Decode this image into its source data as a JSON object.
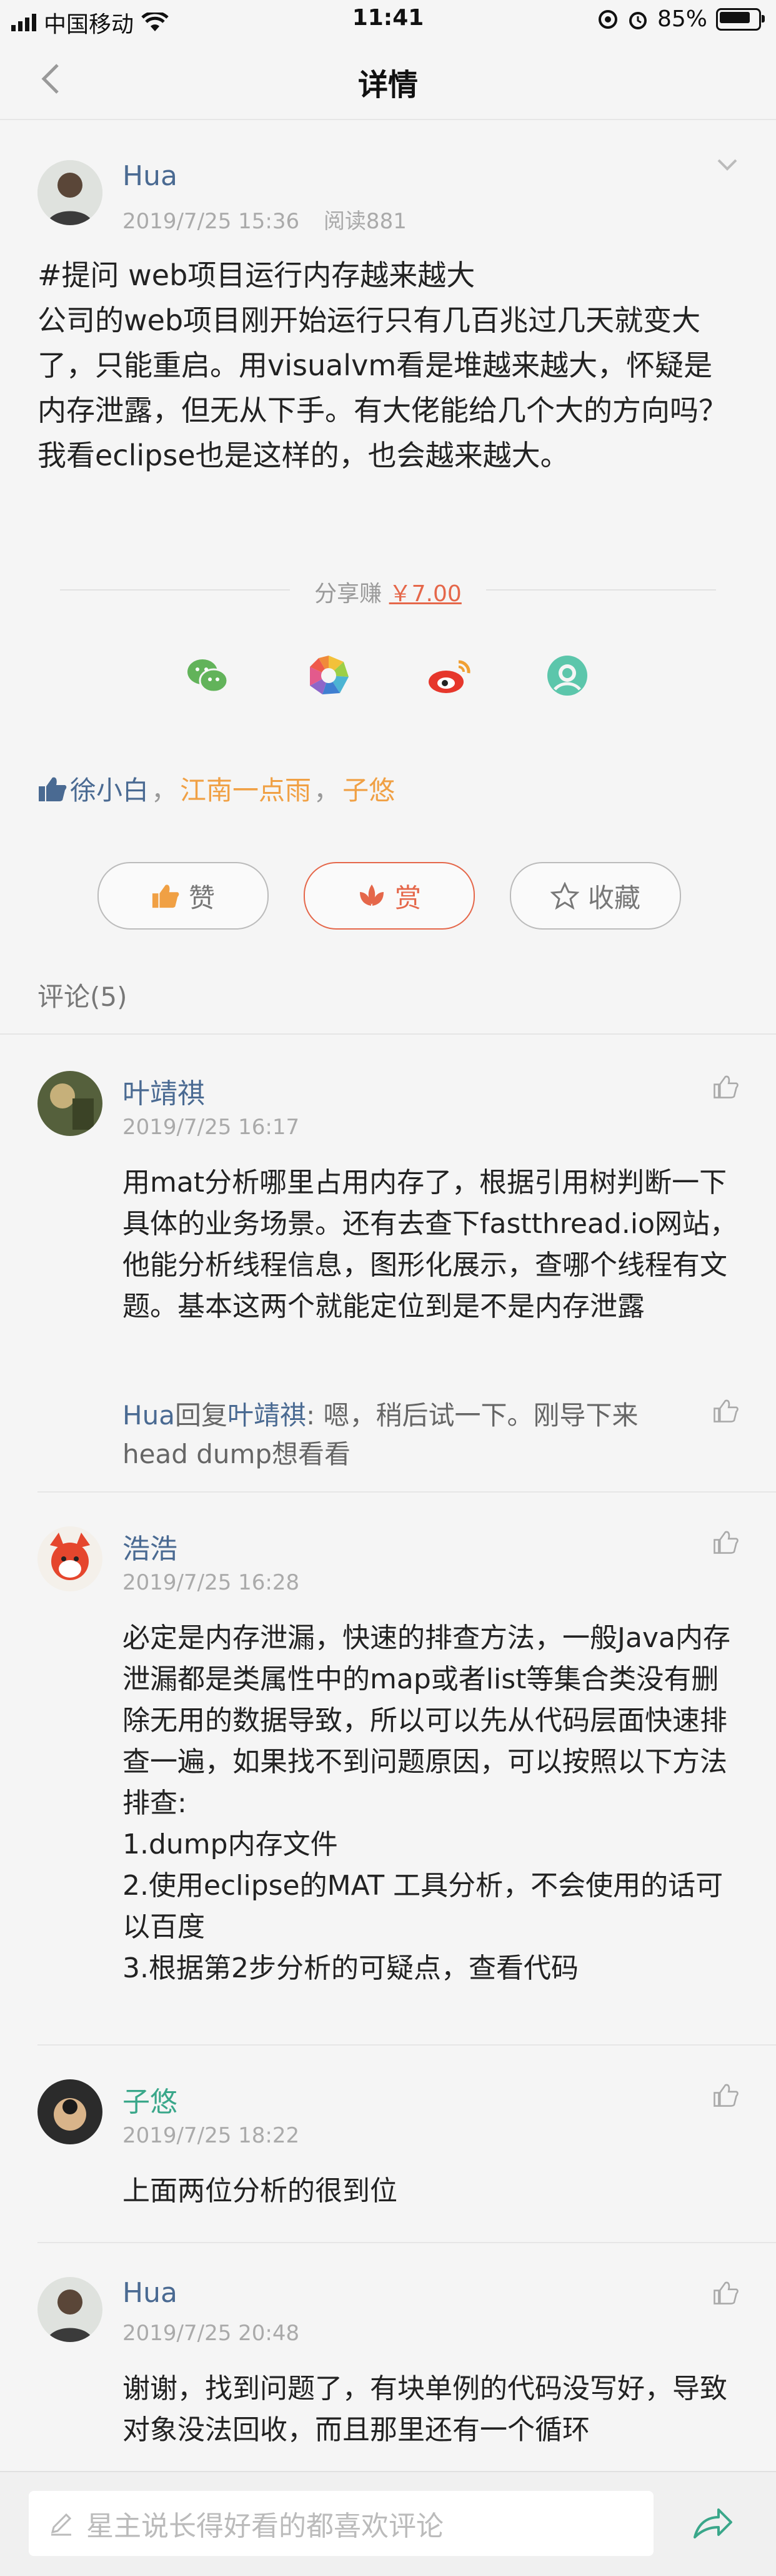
{
  "status_bar": {
    "carrier": "中国移动",
    "time": "11:41",
    "battery": "85%"
  },
  "nav": {
    "title": "详情"
  },
  "post": {
    "author": "Hua",
    "date": "2019/7/25 15:36",
    "reads": "阅读881",
    "content": "#提问 web项目运行内存越来越大\n公司的web项目刚开始运行只有几百兆过几天就变大了，只能重启。用visualvm看是堆越来越大，怀疑是内存泄露，但无从下手。有大佬能给几个大的方向吗？我看eclipse也是这样的，也会越来越大。"
  },
  "share": {
    "label": "分享赚",
    "amount": "￥7.00"
  },
  "share_icons": [
    "wechat-icon",
    "moments-icon",
    "weibo-icon",
    "qzone-icon"
  ],
  "likes": {
    "users": [
      "徐小白",
      "江南一点雨",
      "子悠"
    ],
    "separator": "，"
  },
  "actions": {
    "like_label": "赞",
    "reward_label": "赏",
    "favorite_label": "收藏"
  },
  "comments_header": "评论(5)",
  "comments": [
    {
      "name": "叶靖祺",
      "date": "2019/7/25 16:17",
      "text": "用mat分析哪里占用内存了，根据引用树判断一下具体的业务场景。还有去查下fastthread.io网站，他能分析线程信息，图形化展示，查哪个线程有文题。基本这两个就能定位到是不是内存泄露",
      "reply": {
        "from": "Hua",
        "verb": "回复",
        "to": "叶靖祺",
        "text": ": 嗯，稍后试一下。刚导下来head dump想看看"
      }
    },
    {
      "name": "浩浩",
      "date": "2019/7/25 16:28",
      "text": "必定是内存泄漏，快速的排查方法，一般Java内存泄漏都是类属性中的map或者list等集合类没有删除无用的数据导致，所以可以先从代码层面快速排查一遍，如果找不到问题原因，可以按照以下方法排查:\n1.dump内存文件\n2.使用eclipse的MAT 工具分析，不会使用的话可以百度\n3.根据第2步分析的可疑点，查看代码"
    },
    {
      "name": "子悠",
      "date": "2019/7/25 18:22",
      "text": "上面两位分析的很到位"
    },
    {
      "name": "Hua",
      "date": "2019/7/25 20:48",
      "text": "谢谢，找到问题了，有块单例的代码没写好，导致对象没法回收，而且那里还有一个循环"
    }
  ],
  "input": {
    "placeholder": "星主说长得好看的都喜欢评论"
  },
  "colors": {
    "link_blue": "#4a6a92",
    "accent": "#e5674a",
    "orange_name": "#f0a044"
  }
}
